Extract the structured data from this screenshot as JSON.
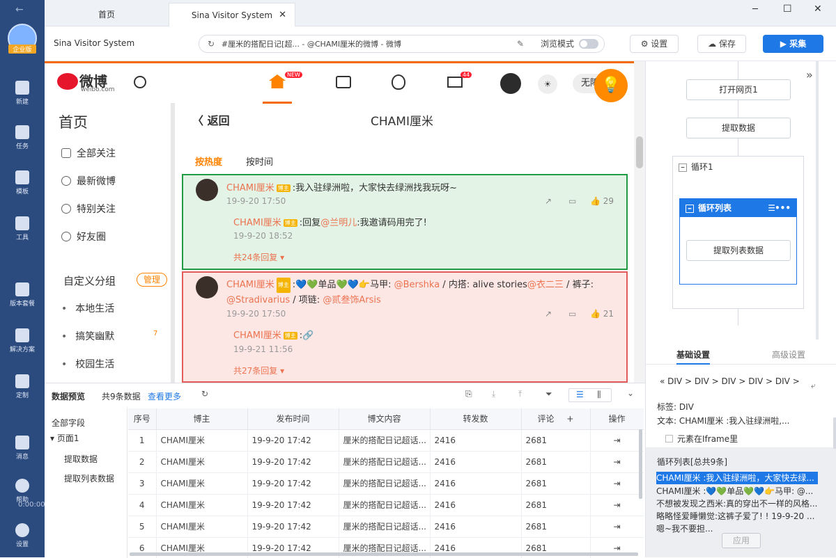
{
  "sidebar": {
    "brand": "企业版",
    "items": [
      {
        "name": "new",
        "label": "新建"
      },
      {
        "name": "task",
        "label": "任务"
      },
      {
        "name": "template",
        "label": "模板"
      },
      {
        "name": "tools",
        "label": "工具"
      },
      {
        "name": "package",
        "label": "版本套餐"
      },
      {
        "name": "solution",
        "label": "解决方案"
      },
      {
        "name": "custom",
        "label": "定制"
      },
      {
        "name": "message",
        "label": "消息"
      },
      {
        "name": "help",
        "label": "帮助"
      },
      {
        "name": "settings",
        "label": "设置"
      }
    ],
    "timer": "0:00:00"
  },
  "tabs": [
    {
      "label": "首页"
    },
    {
      "label": "Sina Visitor System"
    }
  ],
  "window": {
    "minimize": "─",
    "maximize": "☐",
    "close": "✕"
  },
  "toolbar": {
    "page_title": "Sina Visitor System",
    "url": "#厘米的搭配日记[超... - @CHAMI厘米的微博 - 微博",
    "browse_mode": "浏览模式",
    "settings": "设置",
    "save": "保存",
    "collect": "采集"
  },
  "weibo": {
    "logo_cn": "微博",
    "logo_en": "weibo.com",
    "new_badge": "NEW",
    "mail_count": "44",
    "right_btn": "无障",
    "back": "返回",
    "page_user": "CHAMI厘米",
    "sort_hot": "按热度",
    "sort_time": "按时间",
    "side_title": "首页",
    "side_items": [
      "全部关注",
      "最新微博",
      "特别关注",
      "好友圈"
    ],
    "group_title": "自定义分组",
    "group_manage": "管理",
    "groups": [
      "本地生活",
      "搞笑幽默",
      "校园生活"
    ],
    "group_badge": "7",
    "posts": [
      {
        "user": "CHAMI厘米",
        "badge": "博主",
        "text": ":我入驻绿洲啦，大家快去绿洲找我玩呀~",
        "time": "19-9-20 17:50",
        "likes": "29",
        "reply_user": "CHAMI厘米",
        "reply_prefix": ":回复",
        "reply_at": "@兰明儿",
        "reply_rest": ":我邀请码用完了!",
        "reply_time": "19-9-20 18:52",
        "reply_count": "共24条回复"
      },
      {
        "user": "CHAMI厘米",
        "badge": "博主",
        "t1": ":💙💚单品💚💙👉马甲: ",
        "at1": "@Bershka",
        "t2": " / 内搭: alive stories",
        "at2": "@衣二三",
        "t3": " / 裤子: ",
        "at3": "@Stradivarius",
        "t4": " / 项链: ",
        "at4": "@贰叁饰Arsis",
        "time": "19-9-20 17:50",
        "likes": "21",
        "reply_user": "CHAMI厘米",
        "reply_rest": ":🔗",
        "reply_time": "19-9-21 11:56",
        "reply_count": "共27条回复"
      }
    ]
  },
  "flow": {
    "open": "打开网页1",
    "extract": "提取数据",
    "loop": "循环1",
    "loop_list": "循环列表",
    "extract_list": "提取列表数据"
  },
  "panel": {
    "tab_basic": "基础设置",
    "tab_adv": "高级设置",
    "crumbs": [
      "DIV",
      "DIV",
      "DIV",
      "DIV",
      "DIV"
    ],
    "tag_label": "标签:",
    "tag": "DIV",
    "text_label": "文本:",
    "text": "CHAMI厘米 :我入驻绿洲啦,...",
    "iframe": "元素在Iframe里",
    "loop_title": "循环列表[总共9条]",
    "loop_items": [
      "CHAMI厘米 :我入驻绿洲啦，大家快去绿...",
      "CHAMI厘米 :💙💚单品💚💙👉马甲: @...",
      "不想被发现之西米:真的穿出不一样的风格...",
      "略略怪爱睡懒觉:这裤子爱了! ! 19-9-20 ...",
      "嗯~我不要担..."
    ],
    "apply": "应用"
  },
  "preview": {
    "title": "数据预览",
    "count": "共9条数据",
    "more": "查看更多",
    "all_fields": "全部字段",
    "page": "页面1",
    "field1": "提取数据",
    "field2": "提取列表数据",
    "columns": [
      "序号",
      "博主",
      "发布时间",
      "博文内容",
      "转发数",
      "评论",
      "操作"
    ],
    "rows": [
      [
        "1",
        "CHAMI厘米",
        "19-9-20 17:42",
        "厘米的搭配日记超话...",
        "2416",
        "2681"
      ],
      [
        "2",
        "CHAMI厘米",
        "19-9-20 17:42",
        "厘米的搭配日记超话...",
        "2416",
        "2681"
      ],
      [
        "3",
        "CHAMI厘米",
        "19-9-20 17:42",
        "厘米的搭配日记超话...",
        "2416",
        "2681"
      ],
      [
        "4",
        "CHAMI厘米",
        "19-9-20 17:42",
        "厘米的搭配日记超话...",
        "2416",
        "2681"
      ],
      [
        "5",
        "CHAMI厘米",
        "19-9-20 17:42",
        "厘米的搭配日记超话...",
        "2416",
        "2681"
      ],
      [
        "6",
        "CHAMI厘米",
        "19-9-20 17:42",
        "厘米的搭配日记超话...",
        "2416",
        "2681"
      ]
    ]
  }
}
